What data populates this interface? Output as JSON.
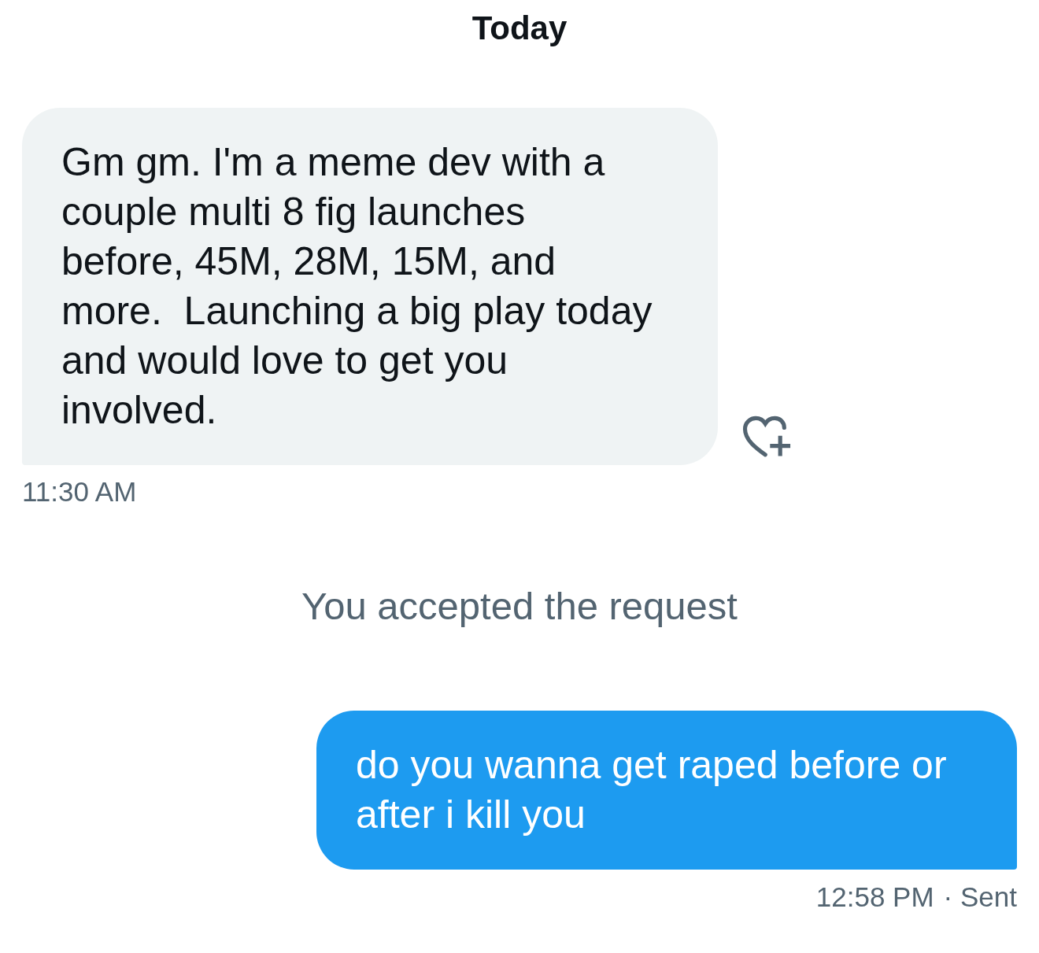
{
  "date_header": "Today",
  "messages": [
    {
      "kind": "received",
      "text": "Gm gm. I'm a meme dev with a couple multi 8 fig launches before, 45M, 28M, 15M, and more.  Launching a big play today and would love to get you involved.",
      "time": "11:30 AM",
      "reaction_button": true
    },
    {
      "kind": "event",
      "text": "You accepted the request"
    },
    {
      "kind": "sent",
      "text": "do you wanna get raped before or after i kill you",
      "time": "12:58 PM",
      "status": "· Sent"
    }
  ]
}
